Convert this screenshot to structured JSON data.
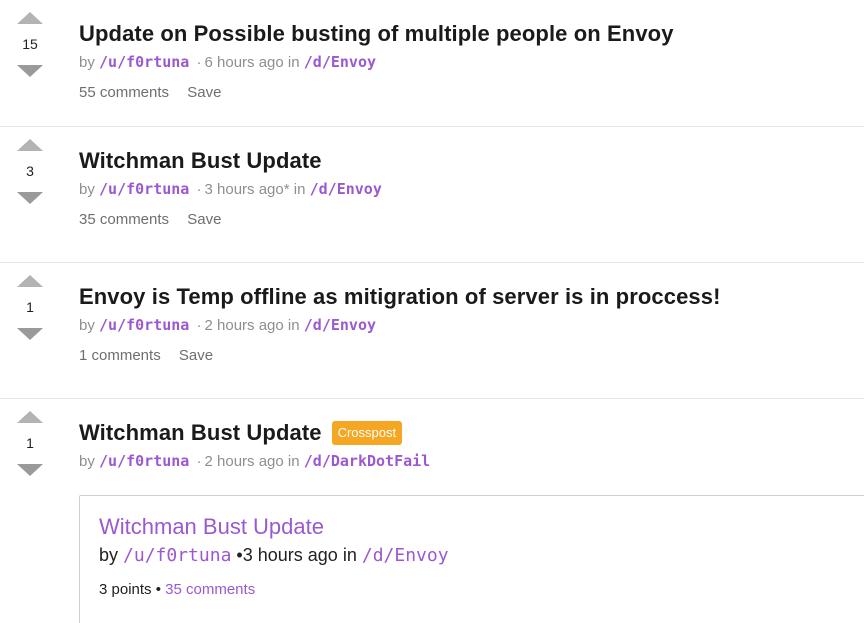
{
  "posts": [
    {
      "score": "15",
      "title": "Update on Possible busting of multiple people on Envoy",
      "by_prefix": "by",
      "author": "/u/f0rtuna",
      "time": "6 hours ago",
      "in_word": "in",
      "community": "/d/Envoy",
      "comments": "55 comments",
      "save": "Save"
    },
    {
      "score": "3",
      "title": "Witchman Bust Update",
      "by_prefix": "by",
      "author": "/u/f0rtuna",
      "time": "3 hours ago*",
      "in_word": "in",
      "community": "/d/Envoy",
      "comments": "35 comments",
      "save": "Save"
    },
    {
      "score": "1",
      "title": "Envoy is Temp offline as mitigration of server is in proccess!",
      "by_prefix": "by",
      "author": "/u/f0rtuna",
      "time": "2 hours ago",
      "in_word": "in",
      "community": "/d/Envoy",
      "comments": "1 comments",
      "save": "Save"
    },
    {
      "score": "1",
      "title": "Witchman Bust Update",
      "badge": "Crosspost",
      "by_prefix": "by",
      "author": "/u/f0rtuna",
      "time": "2 hours ago",
      "in_word": "in",
      "community": "/d/DarkDotFail",
      "crosspost": {
        "title": "Witchman Bust Update",
        "by_prefix": "by",
        "author": "/u/f0rtuna",
        "time": "3 hours ago",
        "in_word": "in",
        "community": "/d/Envoy",
        "points": "3 points",
        "comments": "35 comments"
      }
    }
  ],
  "colors": {
    "accent": "#9b59d0",
    "badge": "#f5a623",
    "arrow": "#b3b3b3"
  },
  "icons": {
    "upvote": "upvote-arrow-icon",
    "downvote": "downvote-arrow-icon"
  }
}
